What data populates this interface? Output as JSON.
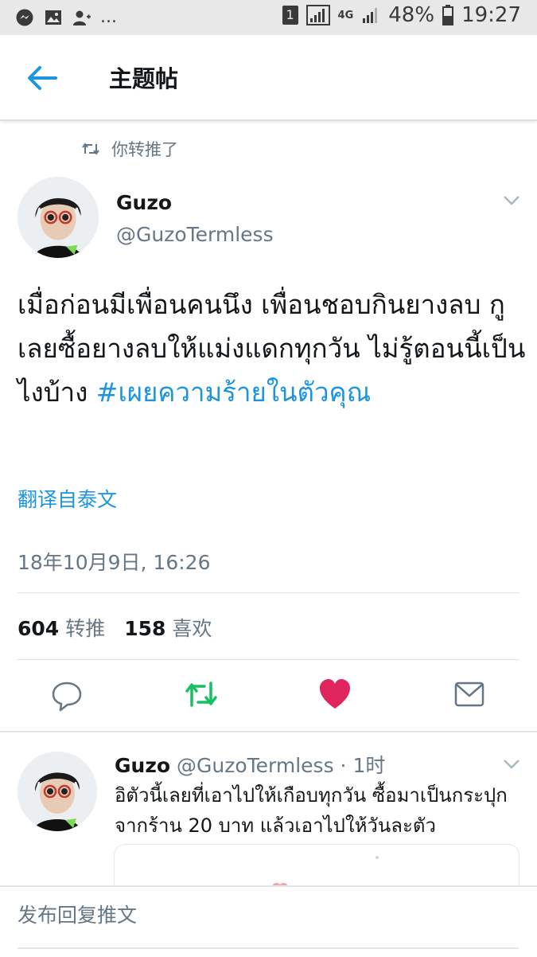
{
  "status_bar": {
    "left_icons": [
      "messenger-icon",
      "image-icon",
      "add-contact-icon"
    ],
    "more": "...",
    "sim": "1",
    "network": "4G",
    "battery": "48%",
    "time": "19:27"
  },
  "header": {
    "title": "主题帖"
  },
  "tweet": {
    "retweet_label": "你转推了",
    "display_name": "Guzo",
    "handle": "@GuzoTermless",
    "text": "เมื่อก่อนมีเพื่อนคนนึง เพื่อนชอบกินยางลบ กูเลยซื้อยางลบให้แม่งแดกทุกวัน ไม่รู้ตอนนี้เป็นไงบ้าง ",
    "hashtag": "#เผยความร้ายในตัวคุณ",
    "translate": "翻译自泰文",
    "timestamp": "18年10月9日, 16:26",
    "retweets_count": "604",
    "retweets_label": "转推",
    "likes_count": "158",
    "likes_label": "喜欢"
  },
  "actions": [
    "reply-icon",
    "retweet-icon",
    "like-icon",
    "share-icon"
  ],
  "colors": {
    "accent": "#1b95e0",
    "retweet": "#17bf63",
    "like": "#e0245e",
    "muted": "#657786"
  },
  "reply": {
    "display_name": "Guzo",
    "handle": "@GuzoTermless",
    "time": " · 1时",
    "text": "อิตัวนี้เลยที่เอาไปให้เกือบทุกวัน ซื้อมาเป็นกระปุกจากร้าน 20 บาท แล้วเอาไปให้วันละตัว"
  },
  "compose": {
    "placeholder": "发布回复推文"
  }
}
